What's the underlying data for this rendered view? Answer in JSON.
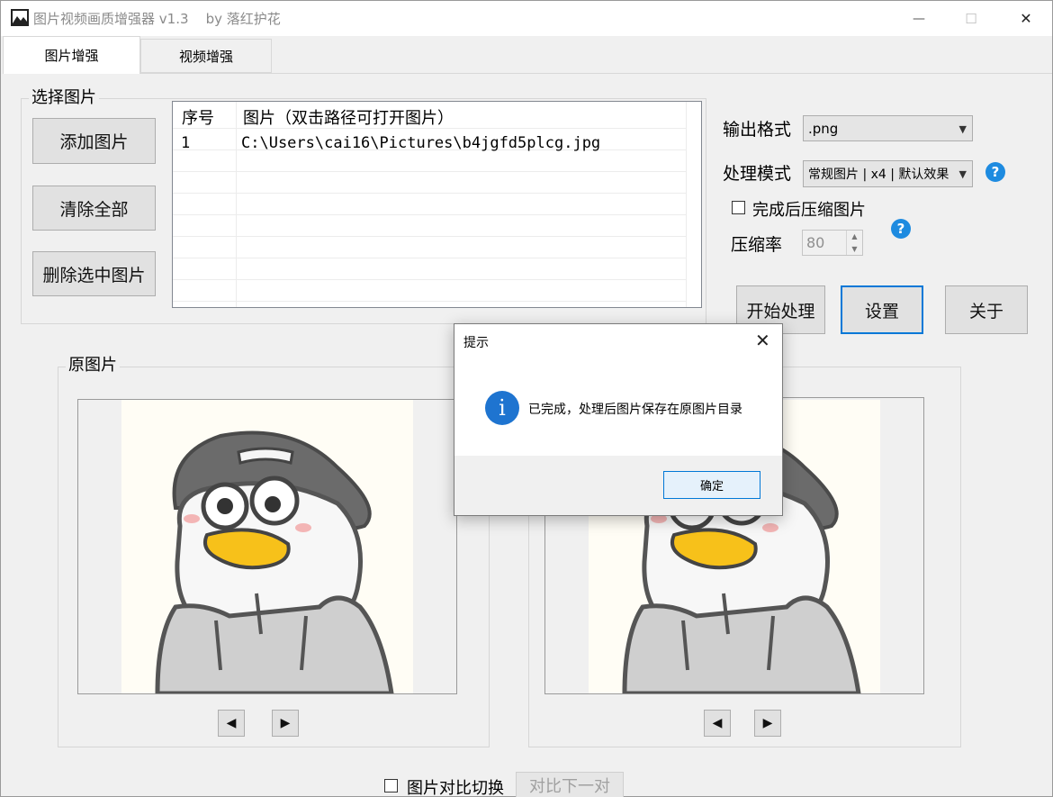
{
  "window": {
    "title": "图片视频画质增强器 v1.3    by 落红护花",
    "minimize": "—",
    "maximize": "☐",
    "close": "✕"
  },
  "tabs": [
    {
      "label": "图片增强",
      "active": true
    },
    {
      "label": "视频增强",
      "active": false
    }
  ],
  "select_images": {
    "title": "选择图片",
    "add_button": "添加图片",
    "clear_button": "清除全部",
    "delete_button": "删除选中图片"
  },
  "list": {
    "columns": [
      "序号",
      "图片（双击路径可打开图片）"
    ],
    "rows": [
      {
        "index": "1",
        "path": "C:\\Users\\cai16\\Pictures\\b4jgfd5plcg.jpg"
      }
    ]
  },
  "settings": {
    "output_format_label": "输出格式",
    "output_format_value": ".png",
    "mode_label": "处理模式",
    "mode_value": "常规图片 | x4 | 默认效果",
    "compress_label": "完成后压缩图片",
    "compress_checked": false,
    "ratio_label": "压缩率",
    "ratio_value": "80",
    "help_icon": "?"
  },
  "actions": {
    "start": "开始处理",
    "settings": "设置",
    "about": "关于"
  },
  "preview": {
    "original_title": "原图片",
    "prev": "◀",
    "next": "▶",
    "compare_label": "图片对比切换",
    "compare_next": "对比下一对"
  },
  "dialog": {
    "title": "提示",
    "close": "✕",
    "icon": "i",
    "message": "已完成，处理后图片保存在原图片目录",
    "ok": "确定"
  }
}
